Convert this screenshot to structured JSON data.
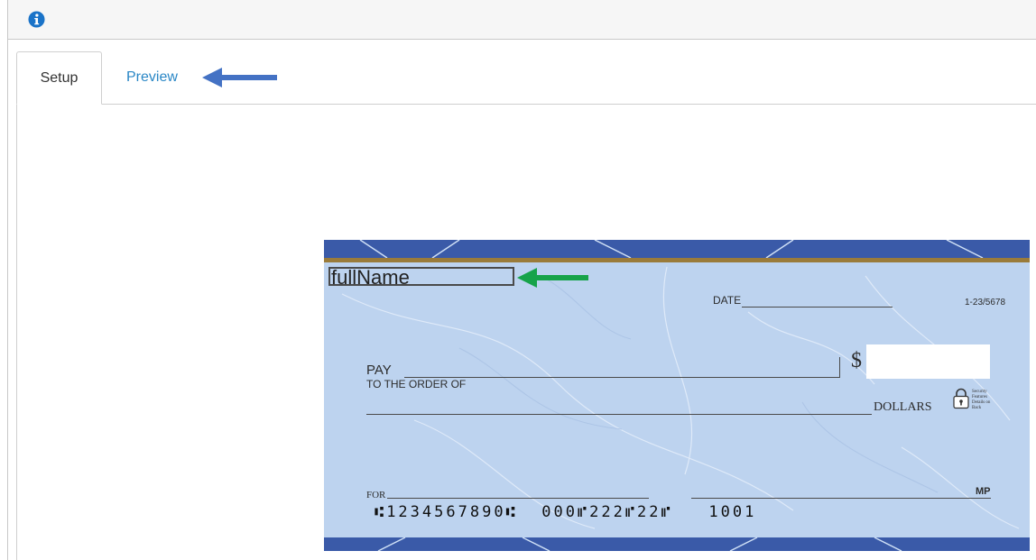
{
  "colors": {
    "accent": "#2a87c6",
    "blue_arrow": "#4472c4",
    "green_arrow": "#17a34a",
    "check_background": "#bcd2ef"
  },
  "header": {
    "icon": "info-icon"
  },
  "tabs": [
    {
      "label": "Setup",
      "active": true
    },
    {
      "label": "Preview",
      "active": false
    }
  ],
  "check": {
    "field_name": "fullName",
    "date_label": "DATE",
    "routing": "1-23/5678",
    "pay_label": "PAY",
    "order_label": "TO THE ORDER OF",
    "dollar_sign": "$",
    "dollars_label": "DOLLARS",
    "security_text": [
      "Security",
      "Features",
      "Details on",
      "Back"
    ],
    "for_label": "FOR",
    "signature_mark": "MP",
    "micr": "⑆1234567890⑆  000⑈222⑈22⑈   1001"
  }
}
